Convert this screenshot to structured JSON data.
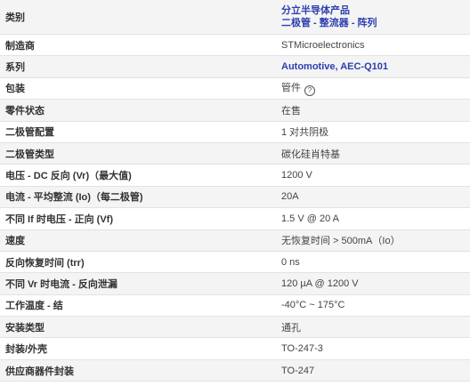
{
  "rows": [
    {
      "label": "类别",
      "lines": [
        "分立半导体产品",
        "二极管 - 整流器 - 阵列"
      ]
    },
    {
      "label": "制造商",
      "value": "STMicroelectronics"
    },
    {
      "label": "系列",
      "value": "Automotive, AEC-Q101"
    },
    {
      "label": "包装",
      "value": "管件",
      "icon": "help-circle-icon"
    },
    {
      "label": "零件状态",
      "value": "在售"
    },
    {
      "label": "二极管配置",
      "value": "1 对共阴极"
    },
    {
      "label": "二极管类型",
      "value": "碳化硅肖特基"
    },
    {
      "label": "电压 - DC 反向 (Vr)（最大值)",
      "value": "1200 V"
    },
    {
      "label": "电流 - 平均整流 (Io)（每二极管)",
      "value": "20A"
    },
    {
      "label": "不同 If 时电压 - 正向 (Vf)",
      "value": "1.5 V @ 20 A"
    },
    {
      "label": "速度",
      "value": "无恢复时间 > 500mA（Io）"
    },
    {
      "label": "反向恢复时间 (trr)",
      "value": "0 ns"
    },
    {
      "label": "不同 Vr 时电流 - 反向泄漏",
      "value": "120 µA @ 1200 V"
    },
    {
      "label": "工作温度 - 结",
      "value": "-40°C ~ 175°C"
    },
    {
      "label": "安装类型",
      "value": "通孔"
    },
    {
      "label": "封装/外壳",
      "value": "TO-247-3"
    },
    {
      "label": "供应商器件封装",
      "value": "TO-247"
    }
  ],
  "colors": {
    "link": "#2b3fb0",
    "row_alt": "#f4f4f4",
    "border": "#e2e2e2"
  }
}
